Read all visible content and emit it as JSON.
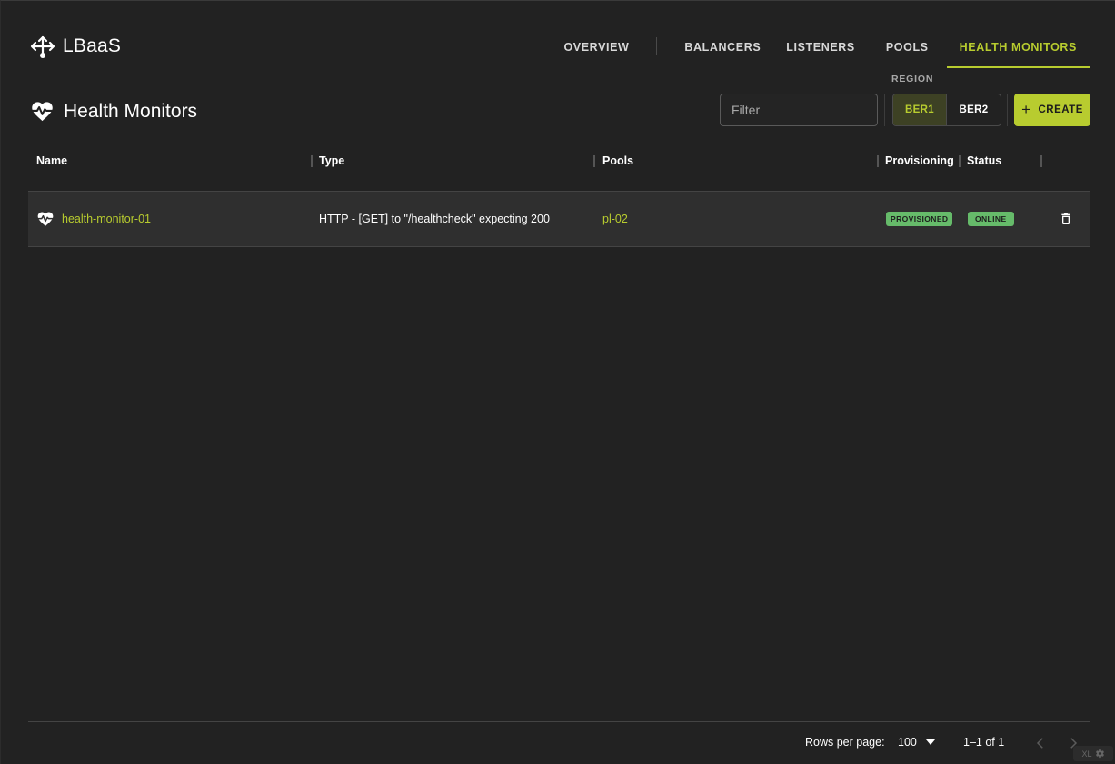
{
  "app": {
    "name": "LBaaS"
  },
  "nav": {
    "items": [
      {
        "label": "OVERVIEW",
        "active": false
      },
      {
        "label": "BALANCERS",
        "active": false
      },
      {
        "label": "LISTENERS",
        "active": false
      },
      {
        "label": "POOLS",
        "active": false
      },
      {
        "label": "HEALTH MONITORS",
        "active": true
      }
    ]
  },
  "page": {
    "title": "Health Monitors"
  },
  "toolbar": {
    "filter_placeholder": "Filter",
    "region_label": "REGION",
    "regions": [
      {
        "label": "BER1",
        "selected": true
      },
      {
        "label": "BER2",
        "selected": false
      }
    ],
    "create_label": "CREATE"
  },
  "table": {
    "columns": [
      "Name",
      "Type",
      "Pools",
      "Provisioning",
      "Status"
    ],
    "rows": [
      {
        "name": "health-monitor-01",
        "type": "HTTP - [GET] to \"/healthcheck\" expecting 200",
        "pools": "pl-02",
        "provisioning": "PROVISIONED",
        "status": "ONLINE"
      }
    ]
  },
  "pagination": {
    "rows_per_page_label": "Rows per page:",
    "rows_per_page_value": "100",
    "range": "1–1 of 1"
  },
  "corner_badge": {
    "label": "XL"
  },
  "colors": {
    "accent": "#b8cc2f",
    "background": "#222222",
    "status_green": "#66bb6a"
  }
}
